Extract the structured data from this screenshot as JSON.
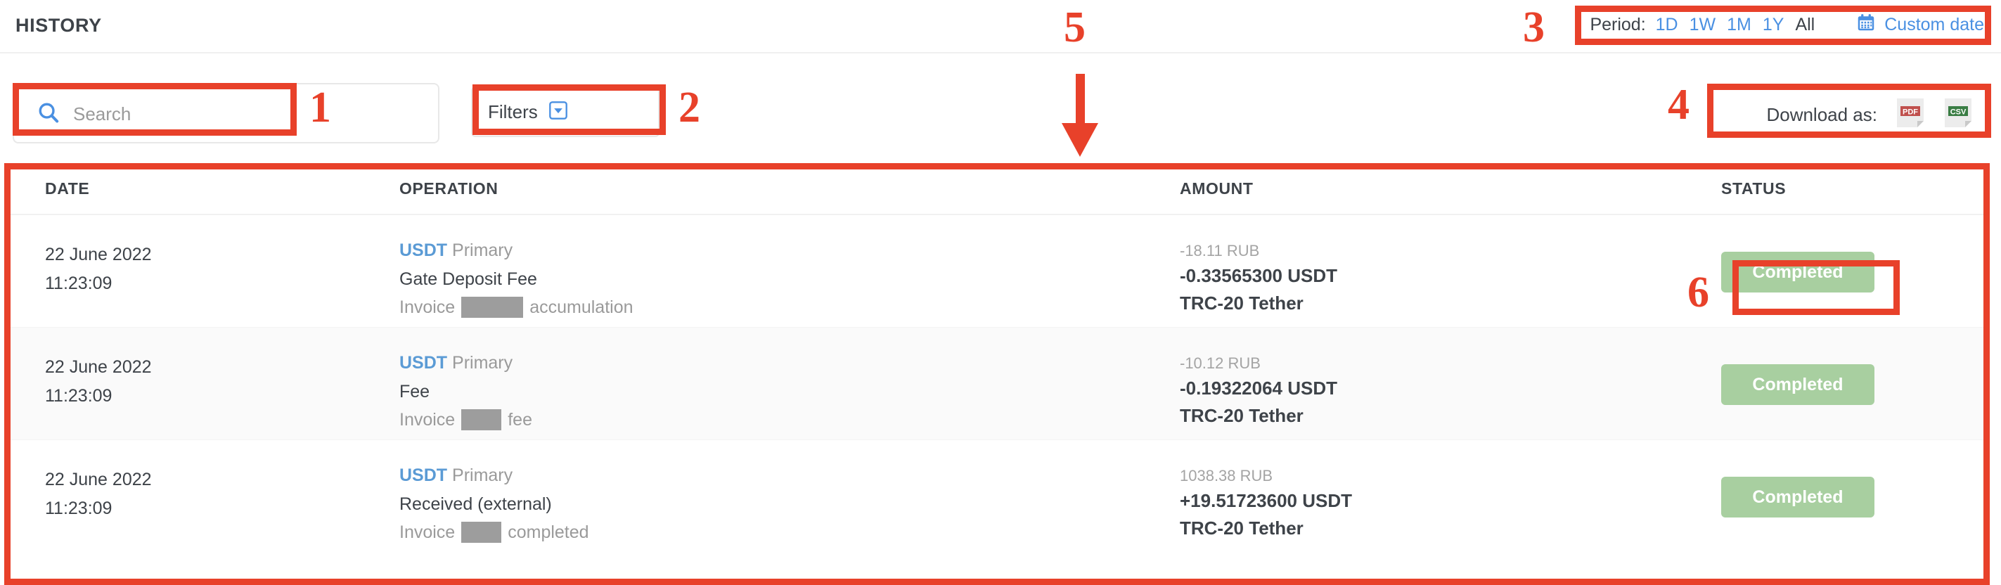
{
  "header": {
    "title": "HISTORY",
    "period": {
      "label": "Period:",
      "options": [
        {
          "label": "1D",
          "active": false
        },
        {
          "label": "1W",
          "active": false
        },
        {
          "label": "1M",
          "active": false
        },
        {
          "label": "1Y",
          "active": false
        },
        {
          "label": "All",
          "active": true
        }
      ],
      "custom_date_label": "Custom date",
      "calendar_icon": "calendar-icon"
    }
  },
  "toolbar": {
    "search_placeholder": "Search",
    "search_value": "",
    "search_icon": "search-icon",
    "filters_label": "Filters",
    "filters_icon": "chevron-down-icon",
    "download_label": "Download as:",
    "download_options": [
      {
        "name": "pdf-download-icon",
        "label": "PDF",
        "badge_color": "#c0504d"
      },
      {
        "name": "csv-download-icon",
        "label": "CSV",
        "badge_color": "#3a7d44"
      }
    ]
  },
  "table": {
    "columns": [
      "DATE",
      "OPERATION",
      "AMOUNT",
      "STATUS"
    ],
    "rows": [
      {
        "date": "22 June 2022",
        "time": "11:23:09",
        "currency": "USDT",
        "account": "Primary",
        "operation": "Gate Deposit Fee",
        "detail_prefix": "Invoice",
        "detail_redacted_width": 88,
        "detail_suffix": "accumulation",
        "amount_fiat": "-18.11 RUB",
        "amount_crypto": "-0.33565300 USDT",
        "network": "TRC-20 Tether",
        "status": "Completed"
      },
      {
        "date": "22 June 2022",
        "time": "11:23:09",
        "currency": "USDT",
        "account": "Primary",
        "operation": "Fee",
        "detail_prefix": "Invoice",
        "detail_redacted_width": 57,
        "detail_suffix": "fee",
        "amount_fiat": "-10.12 RUB",
        "amount_crypto": "-0.19322064 USDT",
        "network": "TRC-20 Tether",
        "status": "Completed"
      },
      {
        "date": "22 June 2022",
        "time": "11:23:09",
        "currency": "USDT",
        "account": "Primary",
        "operation": "Received (external)",
        "detail_prefix": "Invoice",
        "detail_redacted_width": 57,
        "detail_suffix": "completed",
        "amount_fiat": "1038.38 RUB",
        "amount_crypto": "+19.51723600 USDT",
        "network": "TRC-20 Tether",
        "status": "Completed"
      }
    ]
  },
  "annotations": {
    "color": "#e8412a",
    "markers": [
      {
        "number": "1",
        "target": "search-input"
      },
      {
        "number": "2",
        "target": "filters-button"
      },
      {
        "number": "3",
        "target": "period-selector"
      },
      {
        "number": "4",
        "target": "download-as"
      },
      {
        "number": "5",
        "target": "history-table"
      },
      {
        "number": "6",
        "target": "status-badge"
      }
    ]
  },
  "colors": {
    "accent_orange": "#e8412a",
    "link_blue": "#4a90e2",
    "currency_blue": "#5b9bd5",
    "status_green": "#a8cfa0",
    "text_dark": "#3e4349",
    "text_muted": "#9a9a9a"
  }
}
